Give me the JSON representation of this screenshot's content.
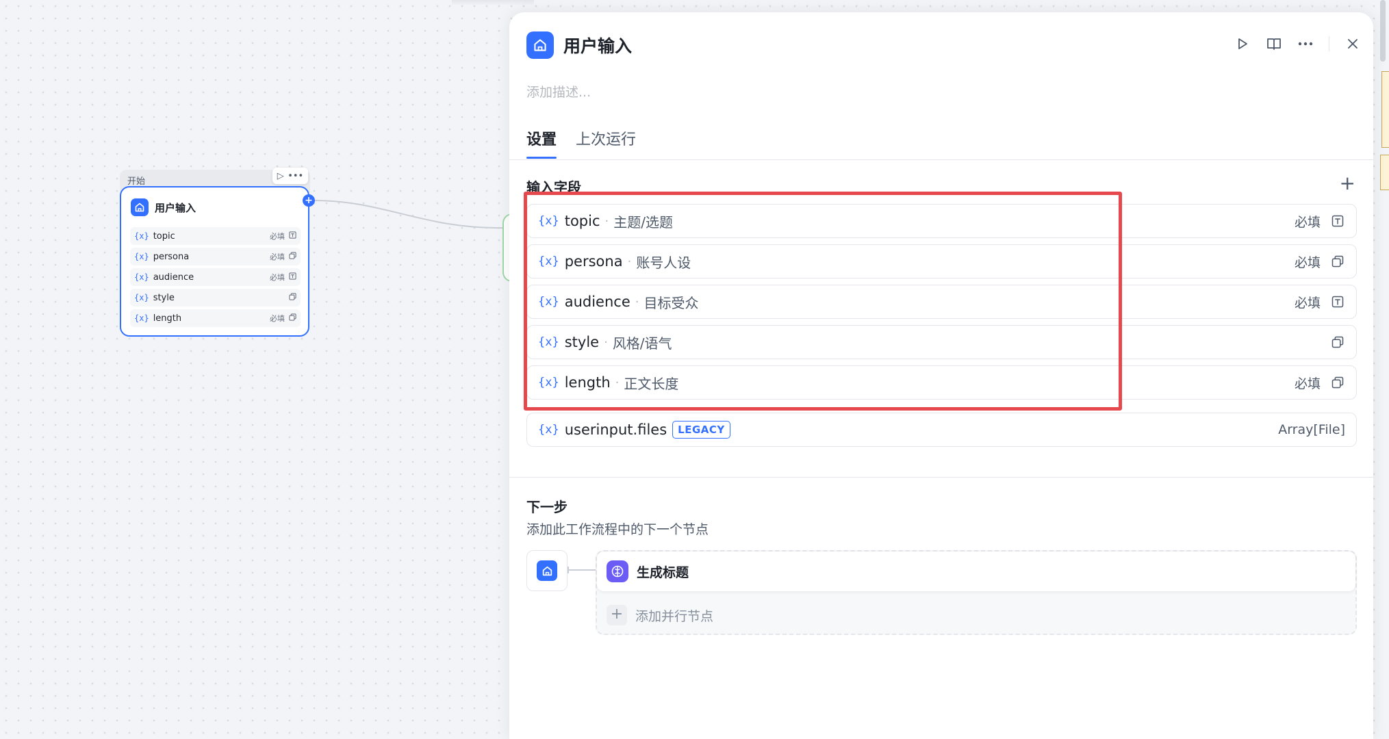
{
  "canvas": {
    "node": {
      "header_label": "开始",
      "title": "用户输入",
      "fields": [
        {
          "var": "{x}",
          "name": "topic",
          "required": "必填",
          "type_icon": "text-input-icon"
        },
        {
          "var": "{x}",
          "name": "persona",
          "required": "必填",
          "type_icon": "paragraph-input-icon"
        },
        {
          "var": "{x}",
          "name": "audience",
          "required": "必填",
          "type_icon": "text-input-icon"
        },
        {
          "var": "{x}",
          "name": "style",
          "required": "",
          "type_icon": "paragraph-input-icon"
        },
        {
          "var": "{x}",
          "name": "length",
          "required": "必填",
          "type_icon": "paragraph-input-icon"
        }
      ]
    }
  },
  "panel": {
    "title": "用户输入",
    "description_placeholder": "添加描述...",
    "tabs": [
      {
        "label": "设置",
        "active": true
      },
      {
        "label": "上次运行",
        "active": false
      }
    ],
    "input_section": {
      "title": "输入字段",
      "fields": [
        {
          "var": "{x}",
          "name": "topic",
          "label": "主题/选题",
          "required": "必填",
          "type_icon": "text-input-icon"
        },
        {
          "var": "{x}",
          "name": "persona",
          "label": "账号人设",
          "required": "必填",
          "type_icon": "paragraph-input-icon"
        },
        {
          "var": "{x}",
          "name": "audience",
          "label": "目标受众",
          "required": "必填",
          "type_icon": "text-input-icon"
        },
        {
          "var": "{x}",
          "name": "style",
          "label": "风格/语气",
          "required": "",
          "type_icon": "paragraph-input-icon"
        },
        {
          "var": "{x}",
          "name": "length",
          "label": "正文长度",
          "required": "必填",
          "type_icon": "paragraph-input-icon"
        }
      ],
      "system_field": {
        "var": "{x}",
        "name": "userinput.files",
        "badge": "LEGACY",
        "type": "Array[File]"
      }
    },
    "next_step": {
      "title": "下一步",
      "description": "添加此工作流程中的下一个节点",
      "next_node_label": "生成标题",
      "add_parallel_label": "添加并行节点"
    }
  },
  "colors": {
    "accent": "#3370ff",
    "highlight": "#e5484d",
    "llm_node": "#6b5cf6"
  }
}
